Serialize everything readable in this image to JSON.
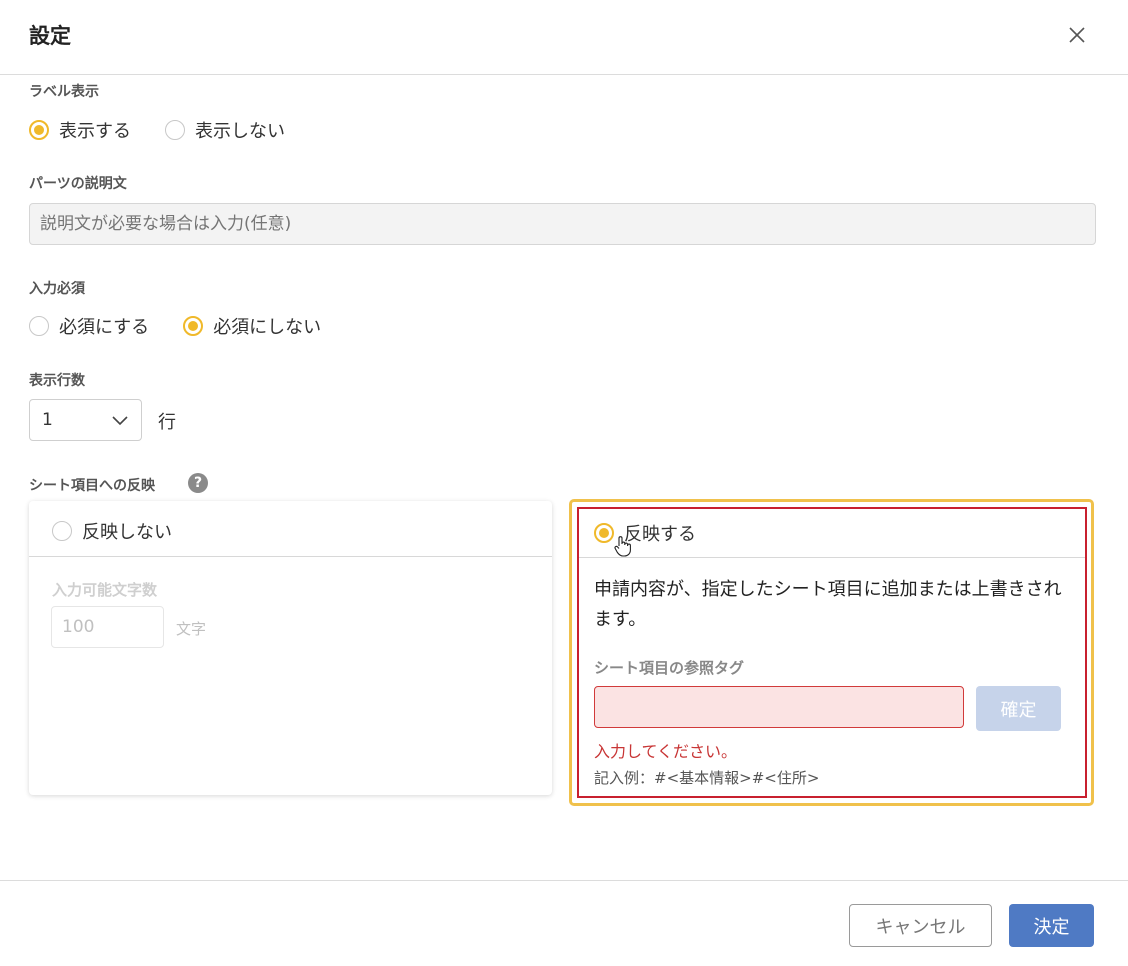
{
  "dialog": {
    "title": "設定",
    "close_icon": "close-icon"
  },
  "label_display": {
    "label": "ラベル表示",
    "options": [
      {
        "label": "表示する",
        "selected": true
      },
      {
        "label": "表示しない",
        "selected": false
      }
    ]
  },
  "description": {
    "label": "パーツの説明文",
    "placeholder": "説明文が必要な場合は入力(任意)",
    "value": ""
  },
  "required": {
    "label": "入力必須",
    "options": [
      {
        "label": "必須にする",
        "selected": false
      },
      {
        "label": "必須にしない",
        "selected": true
      }
    ]
  },
  "rows": {
    "label": "表示行数",
    "selected_value": "1",
    "unit": "行"
  },
  "sheet_reflect": {
    "label": "シート項目への反映",
    "help_icon": "help-icon",
    "no_reflect": {
      "label": "反映しない",
      "selected": false,
      "char_limit_label": "入力可能文字数",
      "char_limit_value": "100",
      "char_limit_unit": "文字"
    },
    "reflect": {
      "label": "反映する",
      "selected": true,
      "description": "申請内容が、指定したシート項目に追加または上書きされます。",
      "tag_label": "シート項目の参照タグ",
      "tag_value": "",
      "confirm_label": "確定",
      "error": "入力してください。",
      "example": "記入例：#<基本情報>#<住所>"
    }
  },
  "footer": {
    "cancel_label": "キャンセル",
    "ok_label": "決定"
  },
  "colors": {
    "accent": "#f0b92a",
    "error": "#c8202f",
    "primary": "#4f7ac4",
    "disabled_button": "#c6d3ea"
  }
}
